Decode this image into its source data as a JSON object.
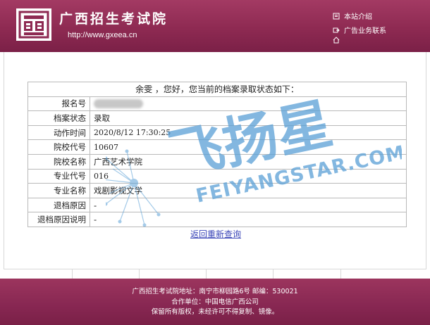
{
  "header": {
    "site_title": "广西招生考试院",
    "site_url": "http://www.gxeea.cn",
    "nav": {
      "about_label": "本站介绍",
      "ads_label": "广告业务联系"
    }
  },
  "result": {
    "heading": "余雯 ，您好，您当前的档案录取状态如下：",
    "rows": [
      {
        "label": "报名号",
        "value": ""
      },
      {
        "label": "档案状态",
        "value": "录取"
      },
      {
        "label": "动作时间",
        "value": "2020/8/12 17:30:25"
      },
      {
        "label": "院校代号",
        "value": "10607"
      },
      {
        "label": "院校名称",
        "value": "广西艺术学院"
      },
      {
        "label": "专业代号",
        "value": "016"
      },
      {
        "label": "专业名称",
        "value": "戏剧影视文学"
      },
      {
        "label": "退档原因",
        "value": "-"
      },
      {
        "label": "退档原因说明",
        "value": "-"
      }
    ],
    "back_link": "返回重新查询"
  },
  "watermark": {
    "logo_text": "飞扬星",
    "domain_text": "FEIYANGSTAR.COM",
    "color": "#5aa0d6"
  },
  "footer": {
    "line1": "广西招生考试院地址：南宁市柳园路6号   邮编：530021",
    "line2": "合作单位：中国电信广西公司",
    "line3": "保留所有版权，未经许可不得复制、镜像。"
  },
  "colors": {
    "brand": "#8e2a52",
    "link": "#3b46b8"
  }
}
